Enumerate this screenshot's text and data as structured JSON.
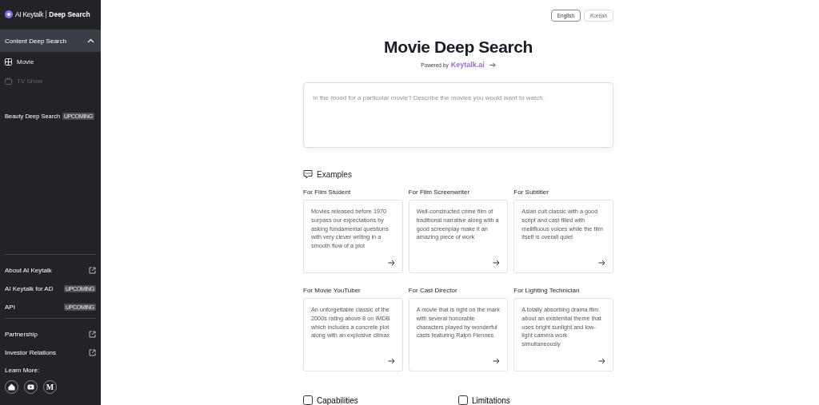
{
  "sidebar": {
    "logo": {
      "brand": "AI Keytalk",
      "product": "Deep Search"
    },
    "sections": [
      {
        "label": "Content Deep Search",
        "expanded": true,
        "items": [
          {
            "label": "Movie",
            "selected": true
          },
          {
            "label": "TV Show",
            "selected": false
          }
        ]
      },
      {
        "label": "Beauty Deep Search",
        "expanded": false,
        "badge": "UPCOMING"
      }
    ],
    "links_group_1": [
      {
        "label": "About AI Keytalk",
        "kind": "external"
      },
      {
        "label": "AI Keytalk for AD",
        "kind": "upcoming",
        "badge": "UPCOMING"
      },
      {
        "label": "API",
        "kind": "upcoming",
        "badge": "UPCOMING"
      }
    ],
    "links_group_2": [
      {
        "label": "Partnership",
        "kind": "external"
      },
      {
        "label": "Investor Relations",
        "kind": "external"
      }
    ],
    "learn_more": {
      "label": "Learn More:",
      "socials": [
        {
          "kind": "home"
        },
        {
          "kind": "video"
        },
        {
          "kind": "medium",
          "text": "M"
        }
      ]
    }
  },
  "languages": [
    {
      "label": "English",
      "selected": true
    },
    {
      "label": "Korean",
      "selected": false
    }
  ],
  "title": "Movie Deep Search",
  "powered_by": {
    "label": "Powered by",
    "brand": "Keytalk.ai"
  },
  "search": {
    "placeholder": "In the mood for a particular movie? Describe the movies you would want to watch."
  },
  "examples": {
    "heading": "Examples",
    "cards": [
      {
        "title": "For Film Student",
        "text": "Movies released before 1970 surpass our expectations by asking fundamental questions with very clever writing in a smooth flow of a plot"
      },
      {
        "title": "For Film Screenwriter",
        "text": "Well-constructed crime film of traditional narrative along with a good screenplay make it an amazing piece of work"
      },
      {
        "title": "For Subtitler",
        "text": "Asian cult classic with a good script and cast filled with mellifluous voices while the film itself is overall quiet"
      },
      {
        "title": "For Movie YouTuber",
        "text": "An unforgettable classic of the 2000s rating above 8 on IMDB which includes a concrete plot along with an explosive climax"
      },
      {
        "title": "For Cast Director",
        "text": "A movie that is right on the mark with several honorable characters played by wonderful casts featuring Ralph Fiennes"
      },
      {
        "title": "For Lighting Technician",
        "text": "A totally absorbing drama film about an existential theme that uses bright sunlight and low-light camera work simultaneously"
      }
    ]
  },
  "bottom_sections": [
    {
      "heading": "Capabilities"
    },
    {
      "heading": "Limitations"
    }
  ]
}
